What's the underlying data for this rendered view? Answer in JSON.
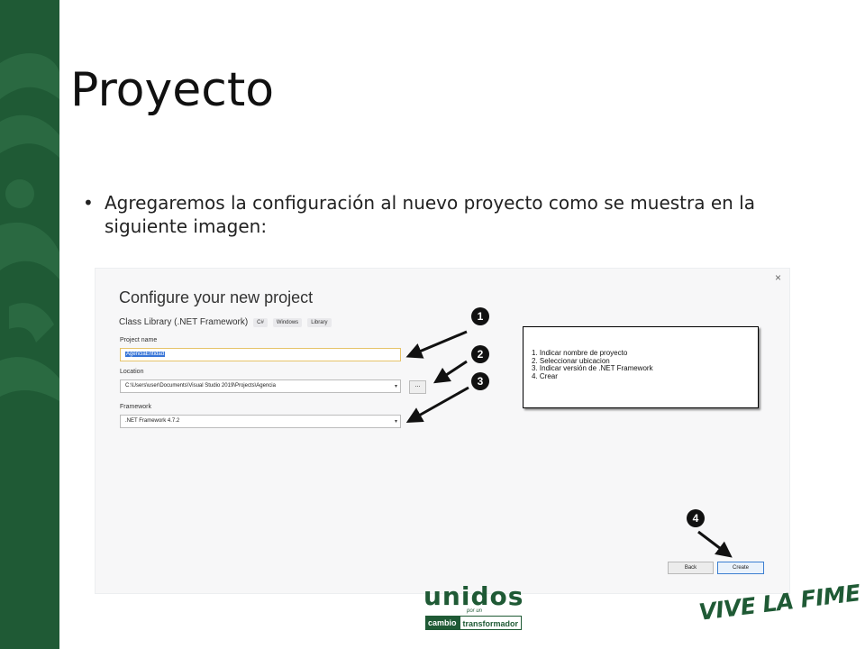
{
  "slide": {
    "title": "Proyecto",
    "bullet": "Agregaremos la configuración al nuevo proyecto como se muestra en la siguiente imagen:"
  },
  "dialog": {
    "close_label": "×",
    "title": "Configure your new project",
    "template_name": "Class Library (.NET Framework)",
    "template_tags": [
      "C#",
      "Windows",
      "Library"
    ],
    "project_name_label": "Project name",
    "project_name_value": "AgenciaEntidad",
    "location_label": "Location",
    "location_value": "C:\\Users\\user\\Documents\\Visual Studio 2019\\Projects\\Agencia",
    "browse_label": "...",
    "framework_label": "Framework",
    "framework_value": ".NET Framework 4.7.2",
    "back_label": "Back",
    "create_label": "Create"
  },
  "annotation": {
    "badges": [
      "1",
      "2",
      "3",
      "4"
    ],
    "notes": [
      "1. Indicar nombre de proyecto",
      "2. Seleccionar ubicacion",
      "3. Indicar versión de .NET Framework",
      "4. Crear"
    ]
  },
  "branding": {
    "unidos": "unidos",
    "por_un": "por un",
    "cambio": "cambio",
    "transformador": "transformador",
    "vive": "VIVE LA FIME"
  },
  "colors": {
    "brand_green": "#1f5a35",
    "selection_blue": "#3875d7",
    "primary_button_border": "#3c7fd1"
  }
}
